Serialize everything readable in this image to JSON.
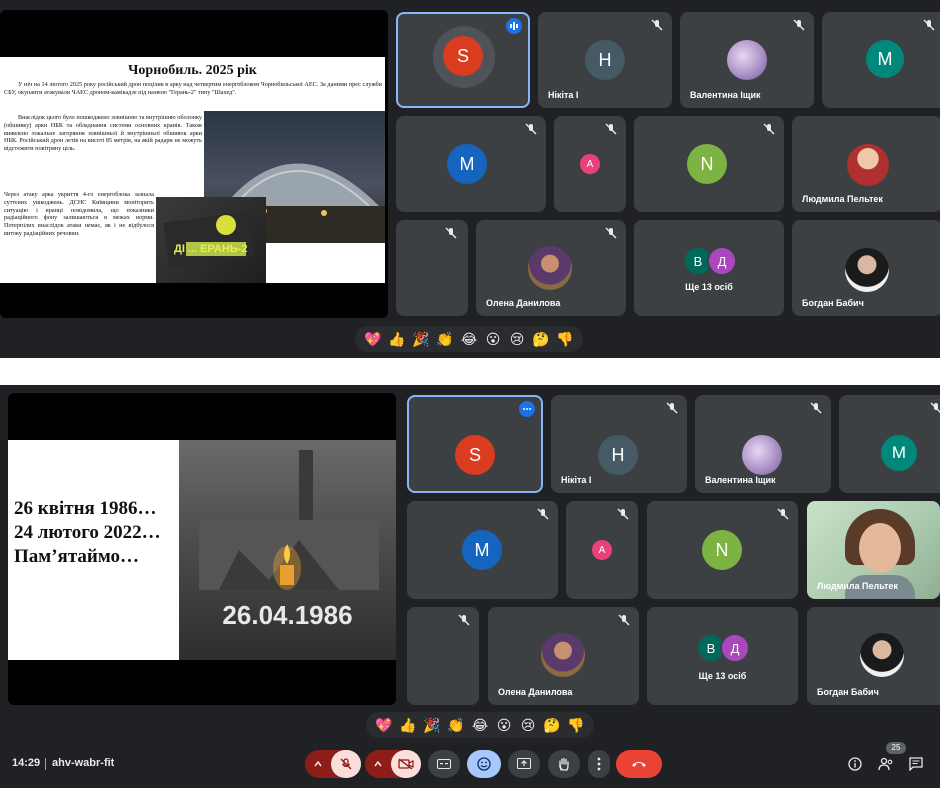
{
  "slide1": {
    "title": "Чорнобиль. 2025 рік",
    "para1": "У ніч на 14 лютого 2025 року російський дрон поцілив в арку над четвертим енергоблоком Чорнобильської АЕС. За даними прес служби СБУ, окупанти атакували ЧАЕС дроном-камікадзе під назвою \"Герань-2\" типу \"Шахед\".",
    "para2": "Внаслідок цього було пошкоджено зовнішню та внутрішню оболонку (обшивку) арки НБК та обладнання системи основних кранів. Також виявлено локальне загоряння зовнішньої й внутрішньої обшивок арки НБК. Російський дрон летів на висоті 85 метрів, на якій радари не можуть відстежити повітряну ціль.",
    "para3": "Через атаку арка укриття 4-го енергоблока зазнала суттєвих ушкоджень. ДСНС Київщини моніторить ситуацію і вранці повідомила, що показники радіаційного фону залишаються в межах норми. Потерпілих внаслідок атаки немає, як і не відбулося витоку радіаційних речовин.",
    "drone_text": "ДІ ... ЕРАНЬ-2"
  },
  "slide2": {
    "line1": "26 квітня 1986…",
    "line2": "24 лютого 2022…",
    "line3": "Пам’ятаймо…",
    "photo_date": "26.04.1986"
  },
  "participants": {
    "s": "S",
    "nikita_initial": "H",
    "nikita": "Нікіта І",
    "valentyna": "Валентина Іщик",
    "m": "M",
    "a": "A",
    "n": "N",
    "lyudmyla": "Людмила Пельтек",
    "olena": "Олена Данилова",
    "more_b": "В",
    "more_d": "Д",
    "more": "Ще 13 осіб",
    "bohdan": "Богдан Бабич"
  },
  "reactions": [
    "💖",
    "👍",
    "🎉",
    "👏",
    "😂",
    "😮",
    "😢",
    "🤔",
    "👎"
  ],
  "toolbar": {
    "time": "14:29",
    "meeting_code": "ahv-wabr-fit",
    "people_count": "25"
  },
  "colors": {
    "s_avatar": "#d93c1e",
    "nikita_avatar": "#455a64",
    "m_avatar_teal": "#00897b",
    "m_avatar_blue": "#1565c0",
    "a_avatar": "#ec407a",
    "n_avatar": "#7cb342",
    "b_avatar": "#00695c",
    "d_avatar": "#ab47bc",
    "leave": "#ea4335",
    "mute_bg": "#f9dedc",
    "mute_dark": "#8c1d18"
  }
}
